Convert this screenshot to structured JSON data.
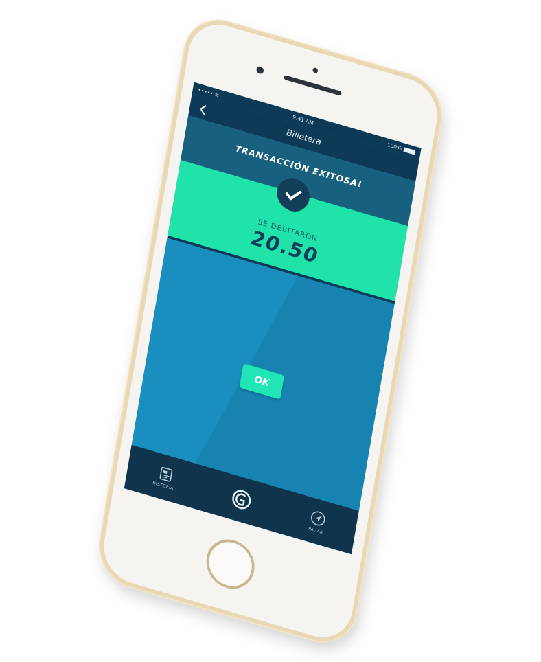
{
  "status_bar": {
    "carrier": "••••• ≋",
    "time": "9:41 AM",
    "battery": "100%"
  },
  "nav": {
    "back_icon": "chevron-left-icon",
    "title": "Billetera"
  },
  "result": {
    "title": "TRANSACCIÓN EXITOSA!",
    "icon": "check-icon",
    "debit_label": "SE DEBITARON",
    "amount": "20.50"
  },
  "actions": {
    "ok_label": "OK"
  },
  "tab_bar": {
    "items": [
      {
        "label": "HISTORIAL",
        "icon": "wallet-card-icon"
      },
      {
        "label": "",
        "icon": "wallet-logo-icon"
      },
      {
        "label": "PAGAR",
        "icon": "send-icon"
      }
    ]
  },
  "colors": {
    "navy": "#0f3a57",
    "teal_band": "#17617f",
    "mint": "#1fe3a9",
    "screen_blue": "#1a8fbf",
    "ok_button": "#22e5b6",
    "phone_frame": "#e8d9b4"
  }
}
